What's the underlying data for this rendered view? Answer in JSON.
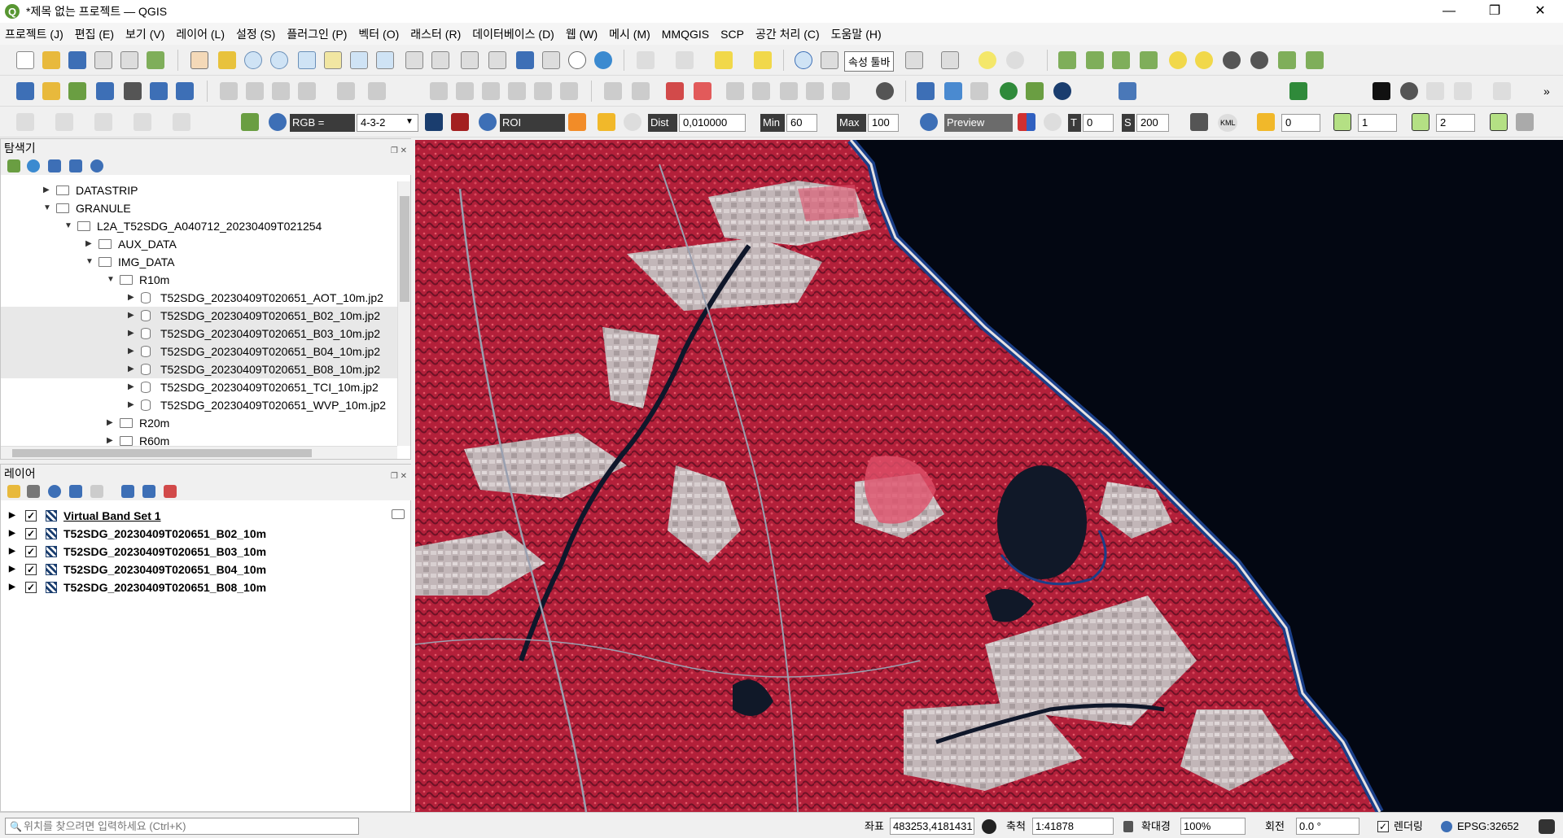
{
  "window": {
    "title": "*제목 없는 프로젝트 — QGIS",
    "min_glyph": "—",
    "max_glyph": "❐",
    "close_glyph": "✕"
  },
  "menu": [
    "프로젝트 (J)",
    "편집 (E)",
    "보기 (V)",
    "레이어 (L)",
    "설정 (S)",
    "플러그인 (P)",
    "벡터 (O)",
    "래스터 (R)",
    "데이터베이스 (D)",
    "웹 (W)",
    "메시 (M)",
    "MMQGIS",
    "SCP",
    "공간 처리 (C)",
    "도움말 (H)"
  ],
  "tooltip": "속성 툴바",
  "scp": {
    "rgb_label": "RGB =",
    "rgb_value": "4-3-2",
    "roi_label": "ROI",
    "dist_label": "Dist",
    "dist_value": "0,010000",
    "min_label": "Min",
    "min_value": "60",
    "max_label": "Max",
    "max_value": "100",
    "preview_label": "Preview",
    "t_label": "T",
    "t_value": "0",
    "s_label": "S",
    "s_value": "200",
    "kml_label": "KML",
    "spin1": "0",
    "spin2": "1",
    "spin3": "2"
  },
  "browser": {
    "title": "탐색기",
    "items": [
      {
        "label": "DATASTRIP",
        "depth": 0,
        "type": "folder",
        "expanded": false,
        "selected": false
      },
      {
        "label": "GRANULE",
        "depth": 0,
        "type": "folder",
        "expanded": true,
        "selected": false
      },
      {
        "label": "L2A_T52SDG_A040712_20230409T021254",
        "depth": 1,
        "type": "folder",
        "expanded": true,
        "selected": false
      },
      {
        "label": "AUX_DATA",
        "depth": 2,
        "type": "folder",
        "expanded": false,
        "selected": false
      },
      {
        "label": "IMG_DATA",
        "depth": 2,
        "type": "folder",
        "expanded": true,
        "selected": false
      },
      {
        "label": "R10m",
        "depth": 3,
        "type": "folder",
        "expanded": true,
        "selected": false
      },
      {
        "label": "T52SDG_20230409T020651_AOT_10m.jp2",
        "depth": 4,
        "type": "raster",
        "expanded": false,
        "selected": false
      },
      {
        "label": "T52SDG_20230409T020651_B02_10m.jp2",
        "depth": 4,
        "type": "raster",
        "expanded": false,
        "selected": true
      },
      {
        "label": "T52SDG_20230409T020651_B03_10m.jp2",
        "depth": 4,
        "type": "raster",
        "expanded": false,
        "selected": true
      },
      {
        "label": "T52SDG_20230409T020651_B04_10m.jp2",
        "depth": 4,
        "type": "raster",
        "expanded": false,
        "selected": true
      },
      {
        "label": "T52SDG_20230409T020651_B08_10m.jp2",
        "depth": 4,
        "type": "raster",
        "expanded": false,
        "selected": true
      },
      {
        "label": "T52SDG_20230409T020651_TCI_10m.jp2",
        "depth": 4,
        "type": "raster",
        "expanded": false,
        "selected": false
      },
      {
        "label": "T52SDG_20230409T020651_WVP_10m.jp2",
        "depth": 4,
        "type": "raster",
        "expanded": false,
        "selected": false
      },
      {
        "label": "R20m",
        "depth": 3,
        "type": "folder",
        "expanded": false,
        "selected": false
      },
      {
        "label": "R60m",
        "depth": 3,
        "type": "folder",
        "expanded": false,
        "selected": false
      }
    ]
  },
  "layers": {
    "title": "레이어",
    "items": [
      {
        "label": "Virtual Band Set 1",
        "checked": true,
        "underline": true
      },
      {
        "label": "T52SDG_20230409T020651_B02_10m",
        "checked": true,
        "underline": false
      },
      {
        "label": "T52SDG_20230409T020651_B03_10m",
        "checked": true,
        "underline": false
      },
      {
        "label": "T52SDG_20230409T020651_B04_10m",
        "checked": true,
        "underline": false
      },
      {
        "label": "T52SDG_20230409T020651_B08_10m",
        "checked": true,
        "underline": false
      }
    ]
  },
  "status": {
    "locator_placeholder": "위치를 찾으려면 입력하세요 (Ctrl+K)",
    "coord_label": "좌표",
    "coord_value": "483253,4181431",
    "scale_label": "축척",
    "scale_value": "1:41878",
    "magnifier_label": "확대경",
    "magnifier_value": "100%",
    "rotation_label": "회전",
    "rotation_value": "0.0 °",
    "render_label": "렌더링",
    "render_checked": true,
    "crs": "EPSG:32652"
  },
  "colors": {
    "vegetation": "#b3203a",
    "urban": "#b9aeb0",
    "sea": "#030712",
    "coast": "#1b3f88",
    "lake": "#101828",
    "accent": "#589632"
  }
}
